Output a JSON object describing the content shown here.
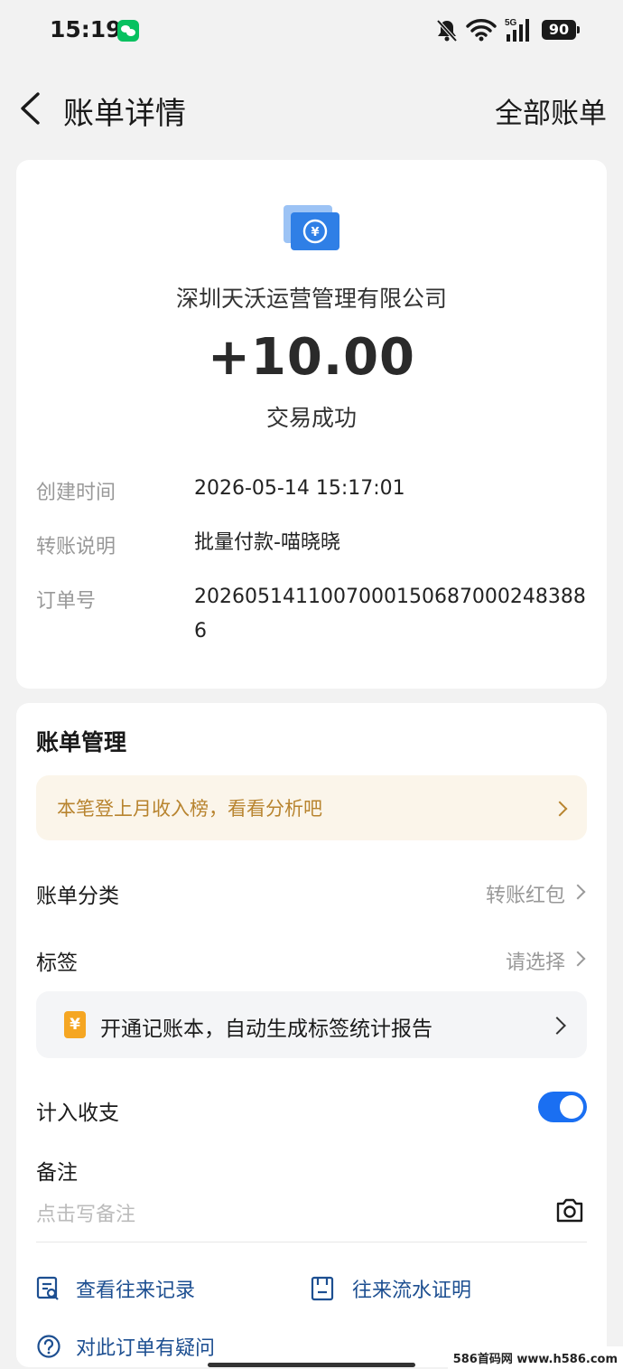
{
  "status": {
    "time": "15:19",
    "battery": "90",
    "network": "5G"
  },
  "nav": {
    "title": "账单详情",
    "right": "全部账单"
  },
  "transaction": {
    "merchant": "深圳天沃运营管理有限公司",
    "amount": "+10.00",
    "status": "交易成功"
  },
  "info": [
    {
      "label": "创建时间",
      "value": "2026-05-14 15:17:01"
    },
    {
      "label": "转账说明",
      "value": "批量付款-喵晓晓"
    },
    {
      "label": "订单号",
      "value": "20260514110070001506870002483886"
    }
  ],
  "management": {
    "title": "账单管理",
    "banner": "本笔登上月收入榜，看看分析吧",
    "category": {
      "label": "账单分类",
      "value": "转账红包"
    },
    "tag": {
      "label": "标签",
      "value": "请选择"
    },
    "promo": {
      "icon": "¥",
      "text": "开通记账本，自动生成标签统计报告"
    },
    "include": {
      "label": "计入收支",
      "on": true
    },
    "remark": {
      "label": "备注",
      "placeholder": "点击写备注"
    }
  },
  "links": {
    "records": "查看往来记录",
    "proof": "往来流水证明",
    "question": "对此订单有疑问"
  },
  "watermark": "586首码网 www.h586.com",
  "colors": {
    "accent": "#1a6ff2",
    "link": "#1d4f91",
    "banner_text": "#b8842f",
    "wechat": "#07c160"
  }
}
